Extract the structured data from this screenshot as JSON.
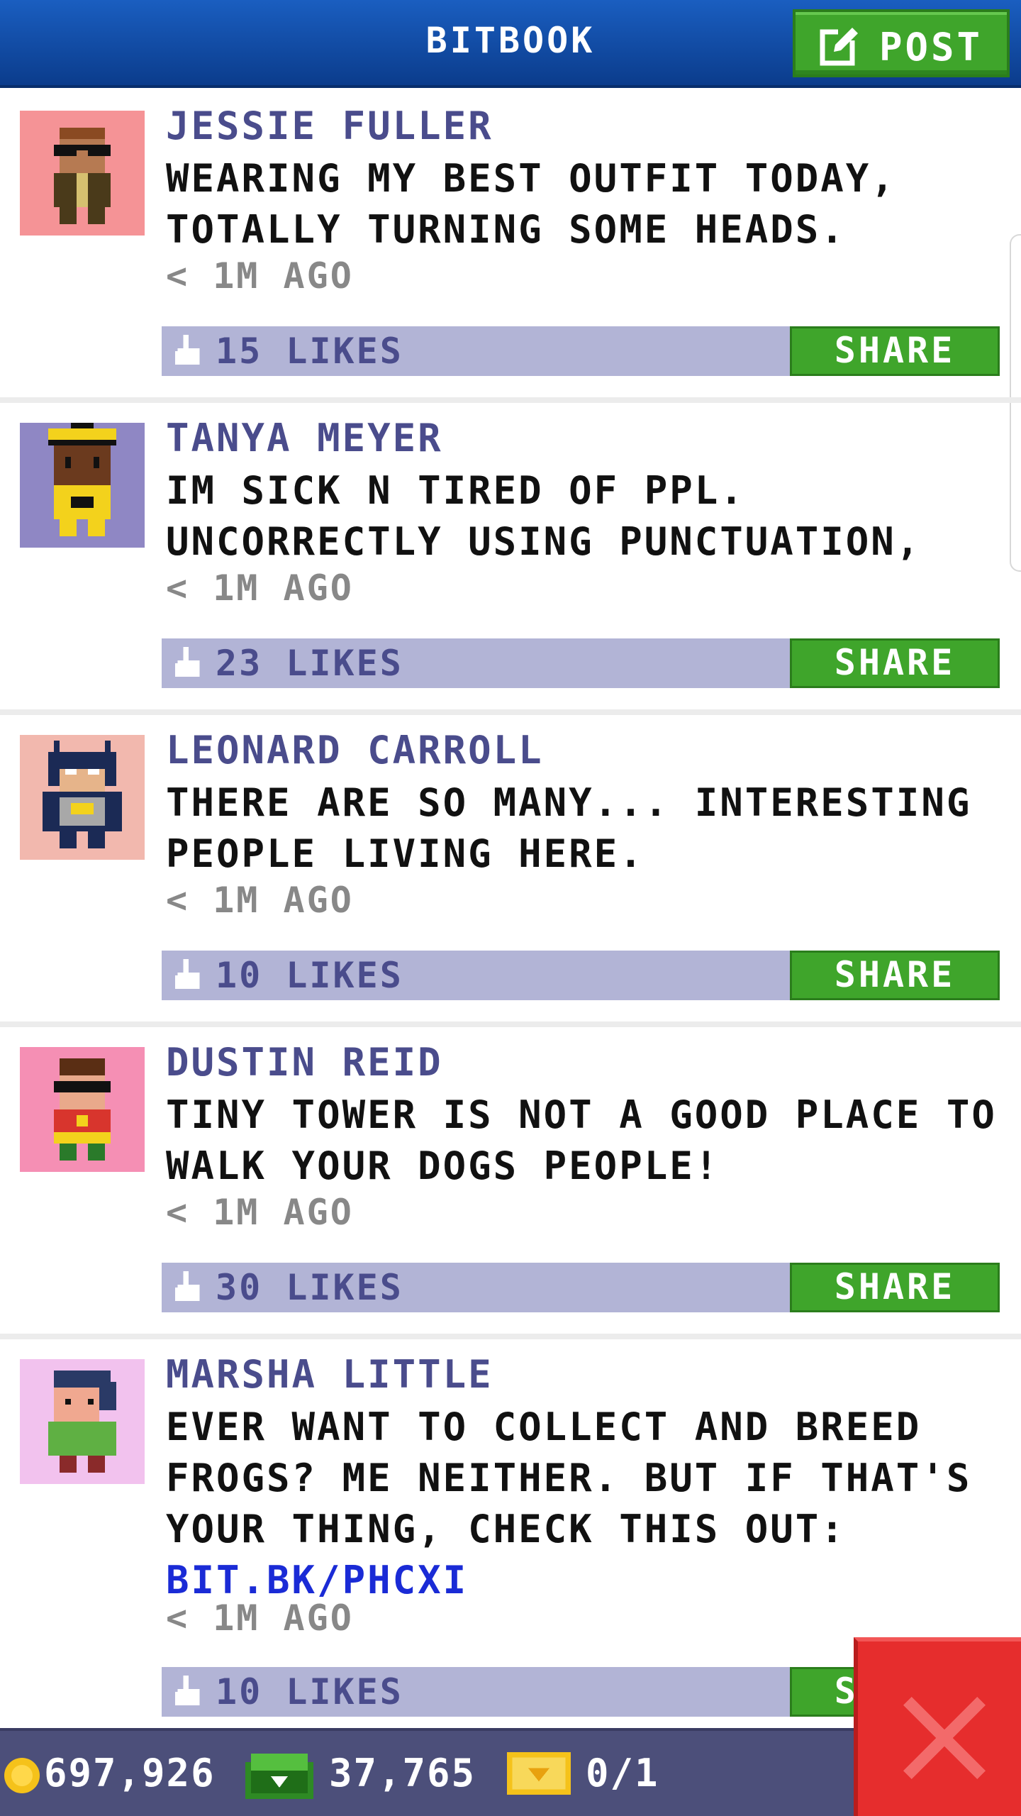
{
  "header": {
    "title": "BITBOOK",
    "post_label": "POST"
  },
  "posts": [
    {
      "author": "JESSIE FULLER",
      "message": "WEARING MY BEST OUTFIT TODAY, TOTALLY TURNING SOME HEADS.",
      "time": "< 1M AGO",
      "likes": "15 LIKES",
      "share_label": "SHARE"
    },
    {
      "author": "TANYA MEYER",
      "message": "IM SICK N TIRED OF PPL. UNCORRECTLY USING PUNCTUATION,",
      "time": "< 1M AGO",
      "likes": "23 LIKES",
      "share_label": "SHARE"
    },
    {
      "author": "LEONARD CARROLL",
      "message": "THERE ARE SO MANY... INTERESTING PEOPLE LIVING HERE.",
      "time": "< 1M AGO",
      "likes": "10 LIKES",
      "share_label": "SHARE"
    },
    {
      "author": "DUSTIN REID",
      "message": "TINY TOWER IS NOT A GOOD PLACE TO WALK YOUR DOGS PEOPLE!",
      "time": "< 1M AGO",
      "likes": "30 LIKES",
      "share_label": "SHARE"
    },
    {
      "author": "MARSHA LITTLE",
      "message": "EVER WANT TO COLLECT AND BREED FROGS? ME NEITHER. BUT IF THAT'S YOUR THING, CHECK THIS OUT:",
      "link": "BIT.BK/PHCXI",
      "time": "< 1M AGO",
      "likes": "10 LIKES",
      "share_label": "SHARE"
    }
  ],
  "status": {
    "coins": "697,926",
    "bux": "37,765",
    "tickets": "0/1"
  },
  "icons": {
    "post": "compose-icon",
    "like": "like-icon",
    "coin": "coin-icon",
    "bux": "bux-icon",
    "ticket": "ticket-icon",
    "close": "close-icon"
  },
  "colors": {
    "header": "#0b3c8c",
    "green": "#3fa52b",
    "like_bar": "#b2b4d6",
    "author": "#4a4c8c",
    "link": "#1a2bd6",
    "close": "#e62d2d",
    "bottom_bar": "#4c4f7a"
  }
}
